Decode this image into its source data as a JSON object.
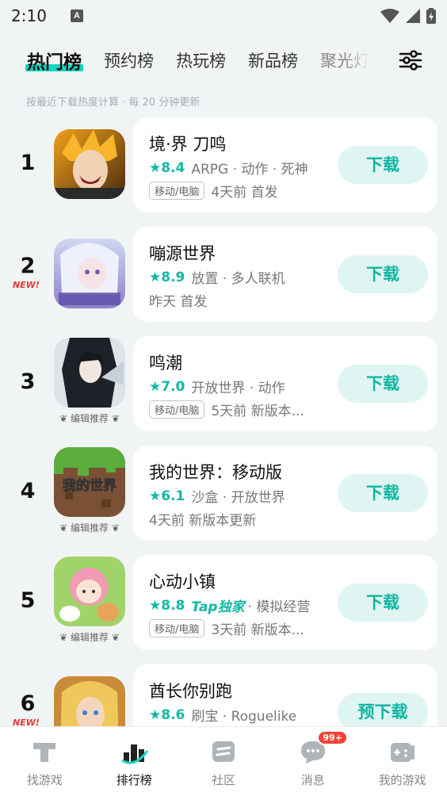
{
  "status": {
    "time": "2:10",
    "icon_a": "A"
  },
  "tabs": [
    {
      "label": "热门榜"
    },
    {
      "label": "预约榜"
    },
    {
      "label": "热玩榜"
    },
    {
      "label": "新品榜"
    },
    {
      "label": "聚光灯"
    }
  ],
  "hint": "按最近下载热度计算 · 每 20 分钟更新",
  "games": [
    {
      "rank": "1",
      "name": "境·界 刀鸣",
      "score": "★8.4",
      "tags": "ARPG · 动作 · 死神",
      "platform": "移动/电脑",
      "info": "4天前 首发",
      "button": "下载"
    },
    {
      "rank": "2",
      "new": "NEW!",
      "name": "嘣源世界",
      "score": "★8.9",
      "tags": "放置 · 多人联机",
      "info": "昨天 首发",
      "button": "下载"
    },
    {
      "rank": "3",
      "editor": "编辑推荐",
      "name": "鸣潮",
      "score": "★7.0",
      "tags": "开放世界 · 动作",
      "platform": "移动/电脑",
      "info": "5天前 新版本...",
      "button": "下载"
    },
    {
      "rank": "4",
      "editor": "编辑推荐",
      "name": "我的世界：移动版",
      "score": "★6.1",
      "tags": "沙盒 · 开放世界",
      "info": "4天前 新版本更新",
      "button": "下载",
      "icon_text": "我的世界"
    },
    {
      "rank": "5",
      "editor": "编辑推荐",
      "name": "心动小镇",
      "score": "★8.8",
      "exclusive": "Tap独家",
      "tags": "· 模拟经营",
      "platform": "移动/电脑",
      "info": "3天前 新版本...",
      "button": "下载"
    },
    {
      "rank": "6",
      "new": "NEW!",
      "name": "酋长你别跑",
      "score": "★8.6",
      "tags": "刷宝 · Roguelike",
      "button": "预下载"
    }
  ],
  "nav": [
    {
      "label": "找游戏"
    },
    {
      "label": "排行榜"
    },
    {
      "label": "社区"
    },
    {
      "label": "消息",
      "badge": "99+"
    },
    {
      "label": "我的游戏"
    }
  ],
  "colors": {
    "accent": "#14d3c0",
    "accent_text": "#10b4a2",
    "button_bg": "#dff5f2",
    "new_red": "#e53935"
  }
}
